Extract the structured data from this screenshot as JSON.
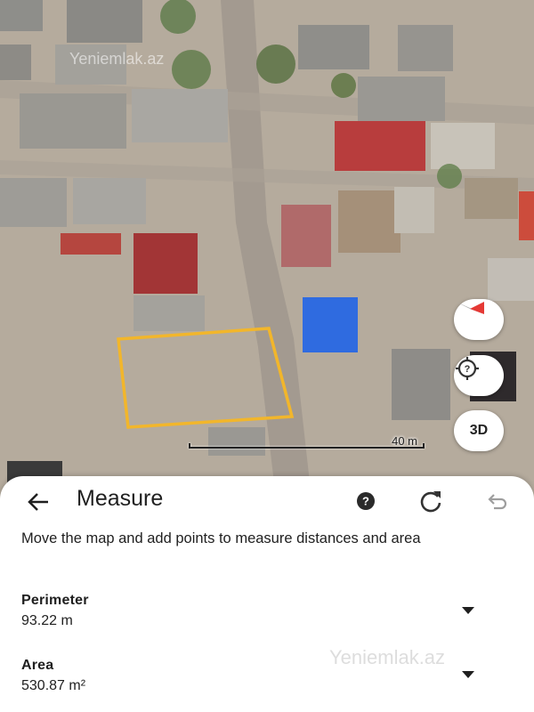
{
  "map": {
    "scale_label": "40 m",
    "watermark": "Yeniemlak.az",
    "button_3d": "3D",
    "measure_outline_color": "#f2b62b",
    "marker_color": "#2f6be0"
  },
  "sheet": {
    "title": "Measure",
    "instruction": "Move the map and add points to measure distances and area",
    "perimeter": {
      "label": "Perimeter",
      "value": "93.22 m"
    },
    "area": {
      "label": "Area",
      "value": "530.87 m²"
    },
    "watermark": "Yeniemlak.az"
  }
}
